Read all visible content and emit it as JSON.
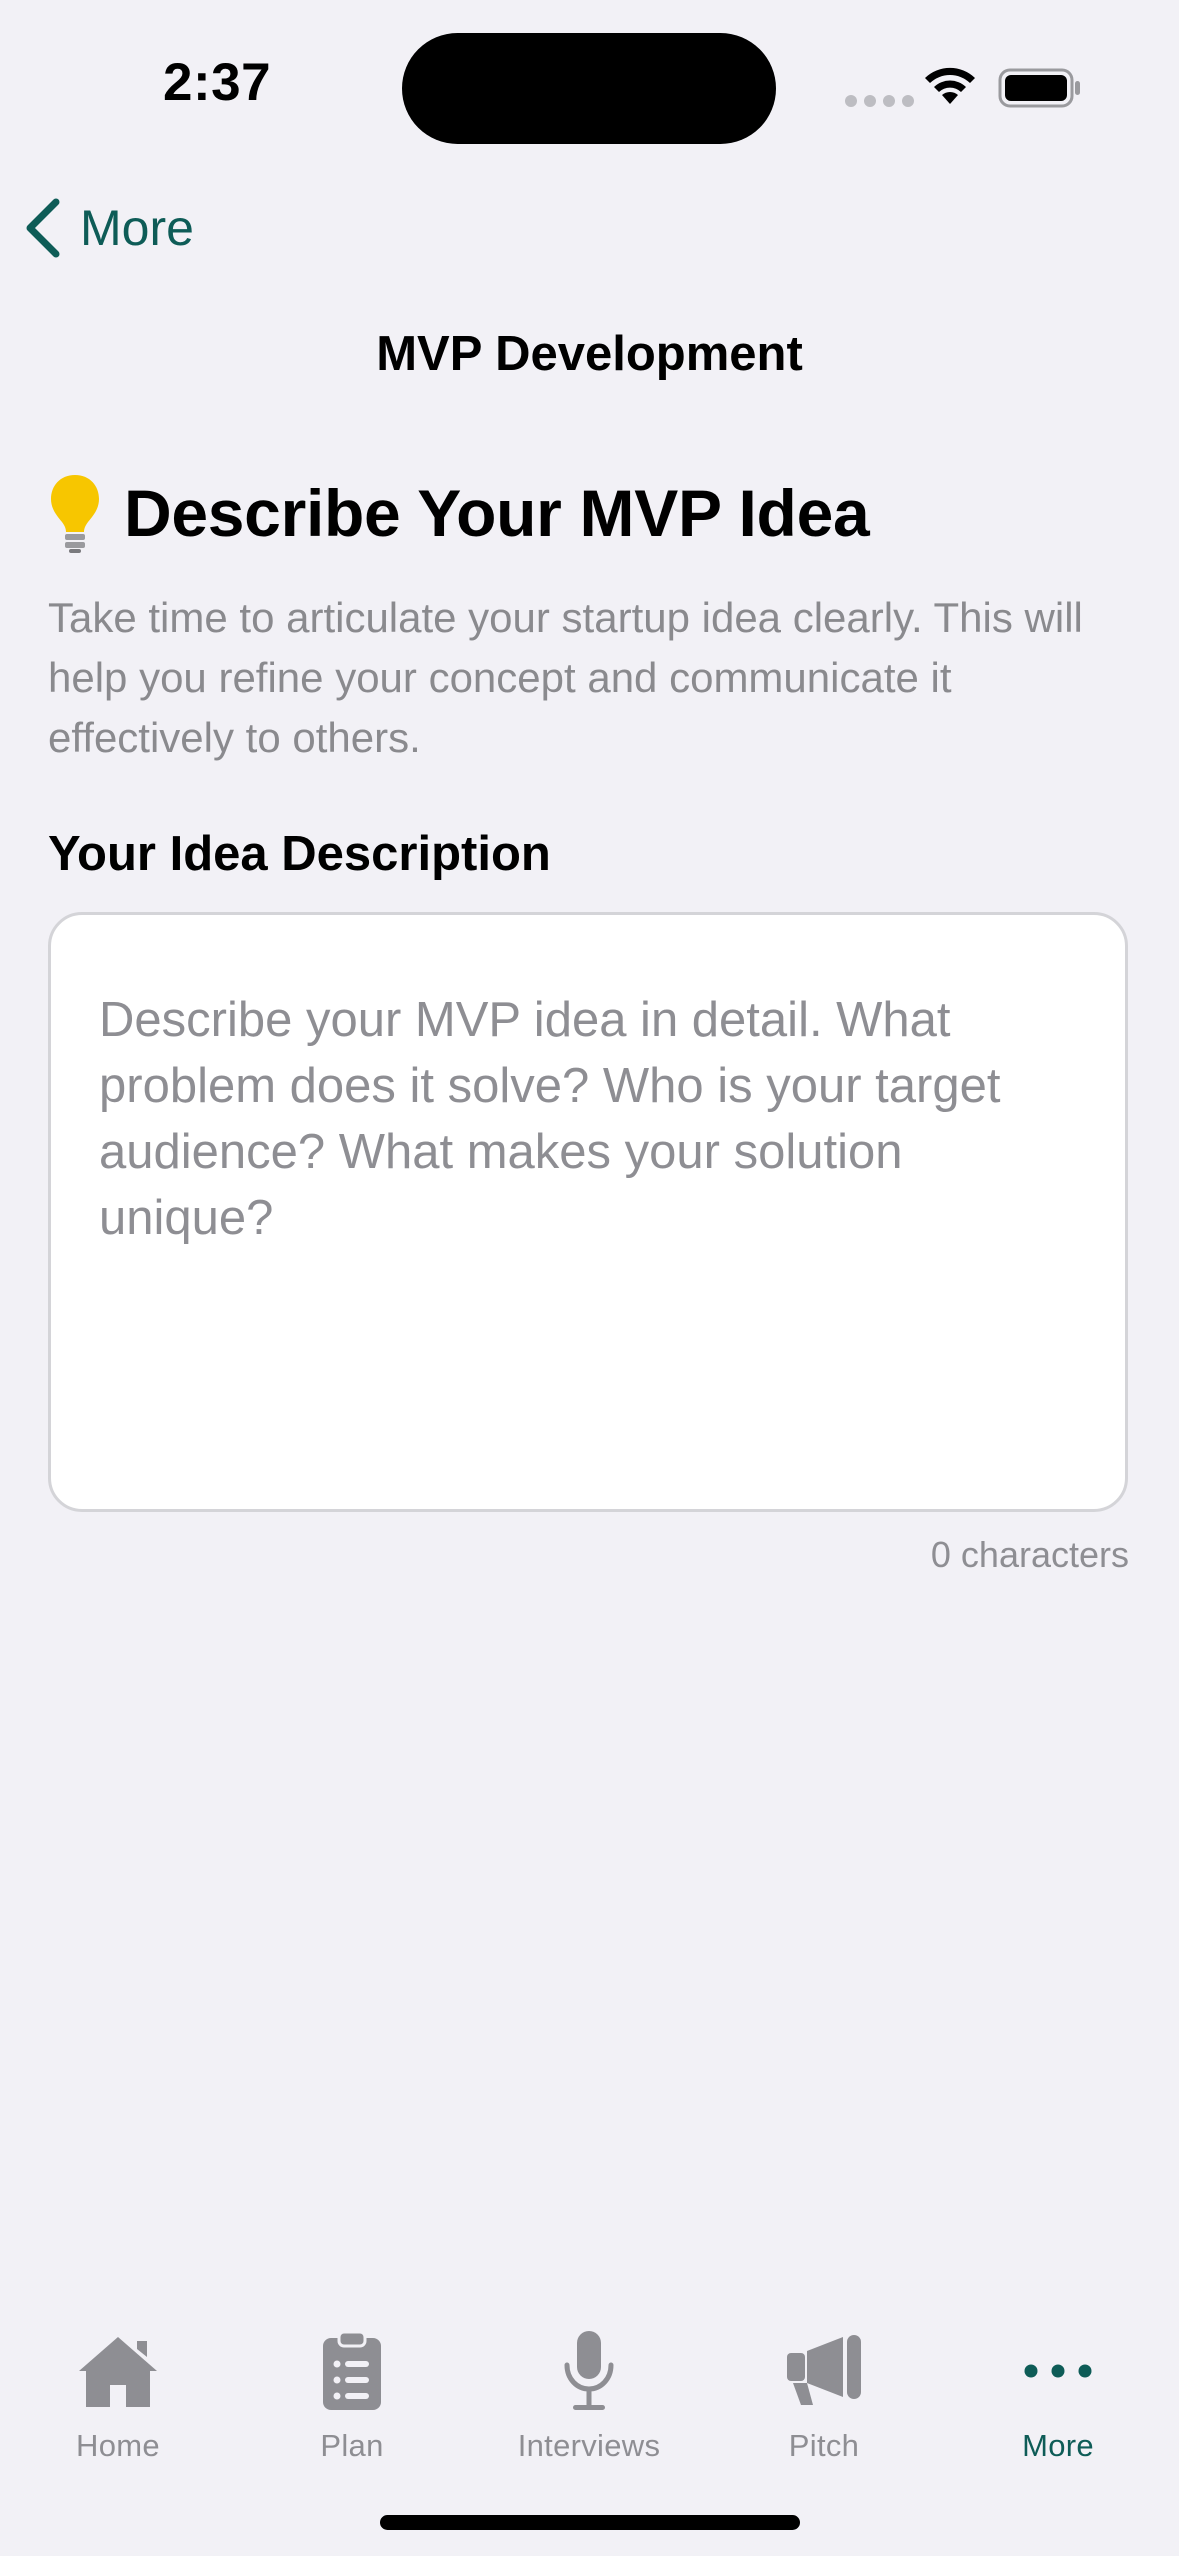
{
  "status_bar": {
    "time": "2:37"
  },
  "nav": {
    "back_label": "More",
    "title": "MVP Development"
  },
  "section": {
    "icon": "lightbulb-icon",
    "title": "Describe Your MVP Idea",
    "intro": "Take time to articulate your startup idea clearly. This will help you refine your concept and communicate it effectively to others."
  },
  "idea_field": {
    "label": "Your Idea Description",
    "value": "",
    "placeholder": "Describe your MVP idea in detail. What problem does it solve? Who is your target audience? What makes your solution unique?",
    "char_count": "0 characters"
  },
  "tabs": [
    {
      "label": "Home",
      "icon": "house-icon",
      "active": false
    },
    {
      "label": "Plan",
      "icon": "clipboard-list-icon",
      "active": false
    },
    {
      "label": "Interviews",
      "icon": "microphone-icon",
      "active": false
    },
    {
      "label": "Pitch",
      "icon": "megaphone-icon",
      "active": false
    },
    {
      "label": "More",
      "icon": "ellipsis-icon",
      "active": true
    }
  ],
  "colors": {
    "accent": "#0E5C57",
    "background": "#F2F1F6",
    "inactive": "#8E8E93",
    "bulb": "#F7C600"
  }
}
